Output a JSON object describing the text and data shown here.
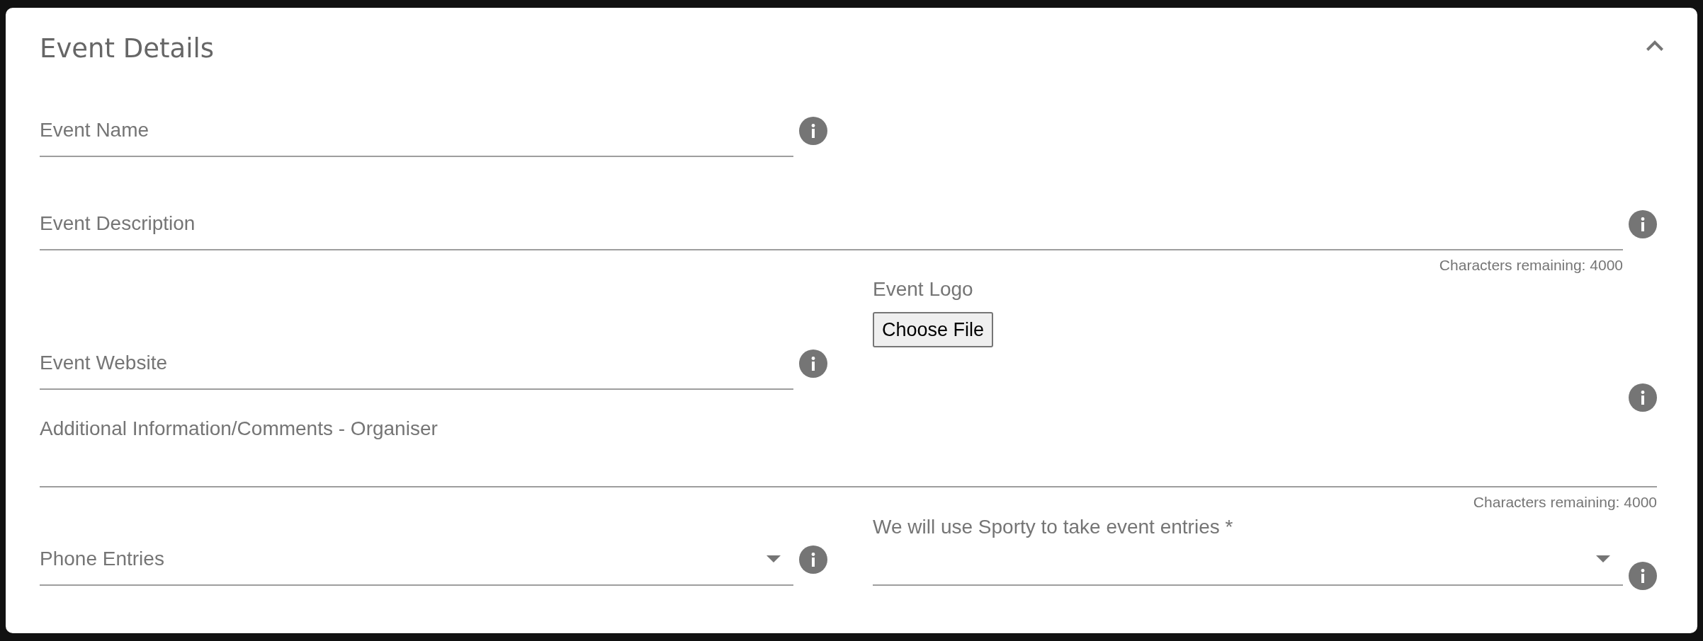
{
  "panel": {
    "title": "Event Details",
    "expanded": true
  },
  "rows": [
    {
      "cells": [
        {
          "kind": "text",
          "label": "Event Name",
          "label_above": false,
          "info": true
        }
      ]
    },
    {
      "cells": [
        {
          "kind": "textarea",
          "label": "Event Description",
          "label_above": false,
          "info": true,
          "helper": "Characters remaining: 4000"
        }
      ]
    },
    {
      "cells": [
        {
          "kind": "text",
          "label": "Event Website",
          "label_above": false,
          "info": true
        },
        {
          "kind": "file",
          "label": "Event Logo",
          "button": "Choose File",
          "info": true
        }
      ]
    },
    {
      "cells": [
        {
          "kind": "textarea",
          "label": "Additional Information/Comments - Organiser",
          "label_above": true,
          "info": false,
          "helper": "Characters remaining: 4000"
        }
      ]
    },
    {
      "cells": [
        {
          "kind": "select",
          "label": "Phone Entries",
          "label_above": false,
          "info": true
        },
        {
          "kind": "select",
          "label": "We will use Sporty to take event entries *",
          "label_above": true,
          "info": true
        }
      ]
    }
  ]
}
